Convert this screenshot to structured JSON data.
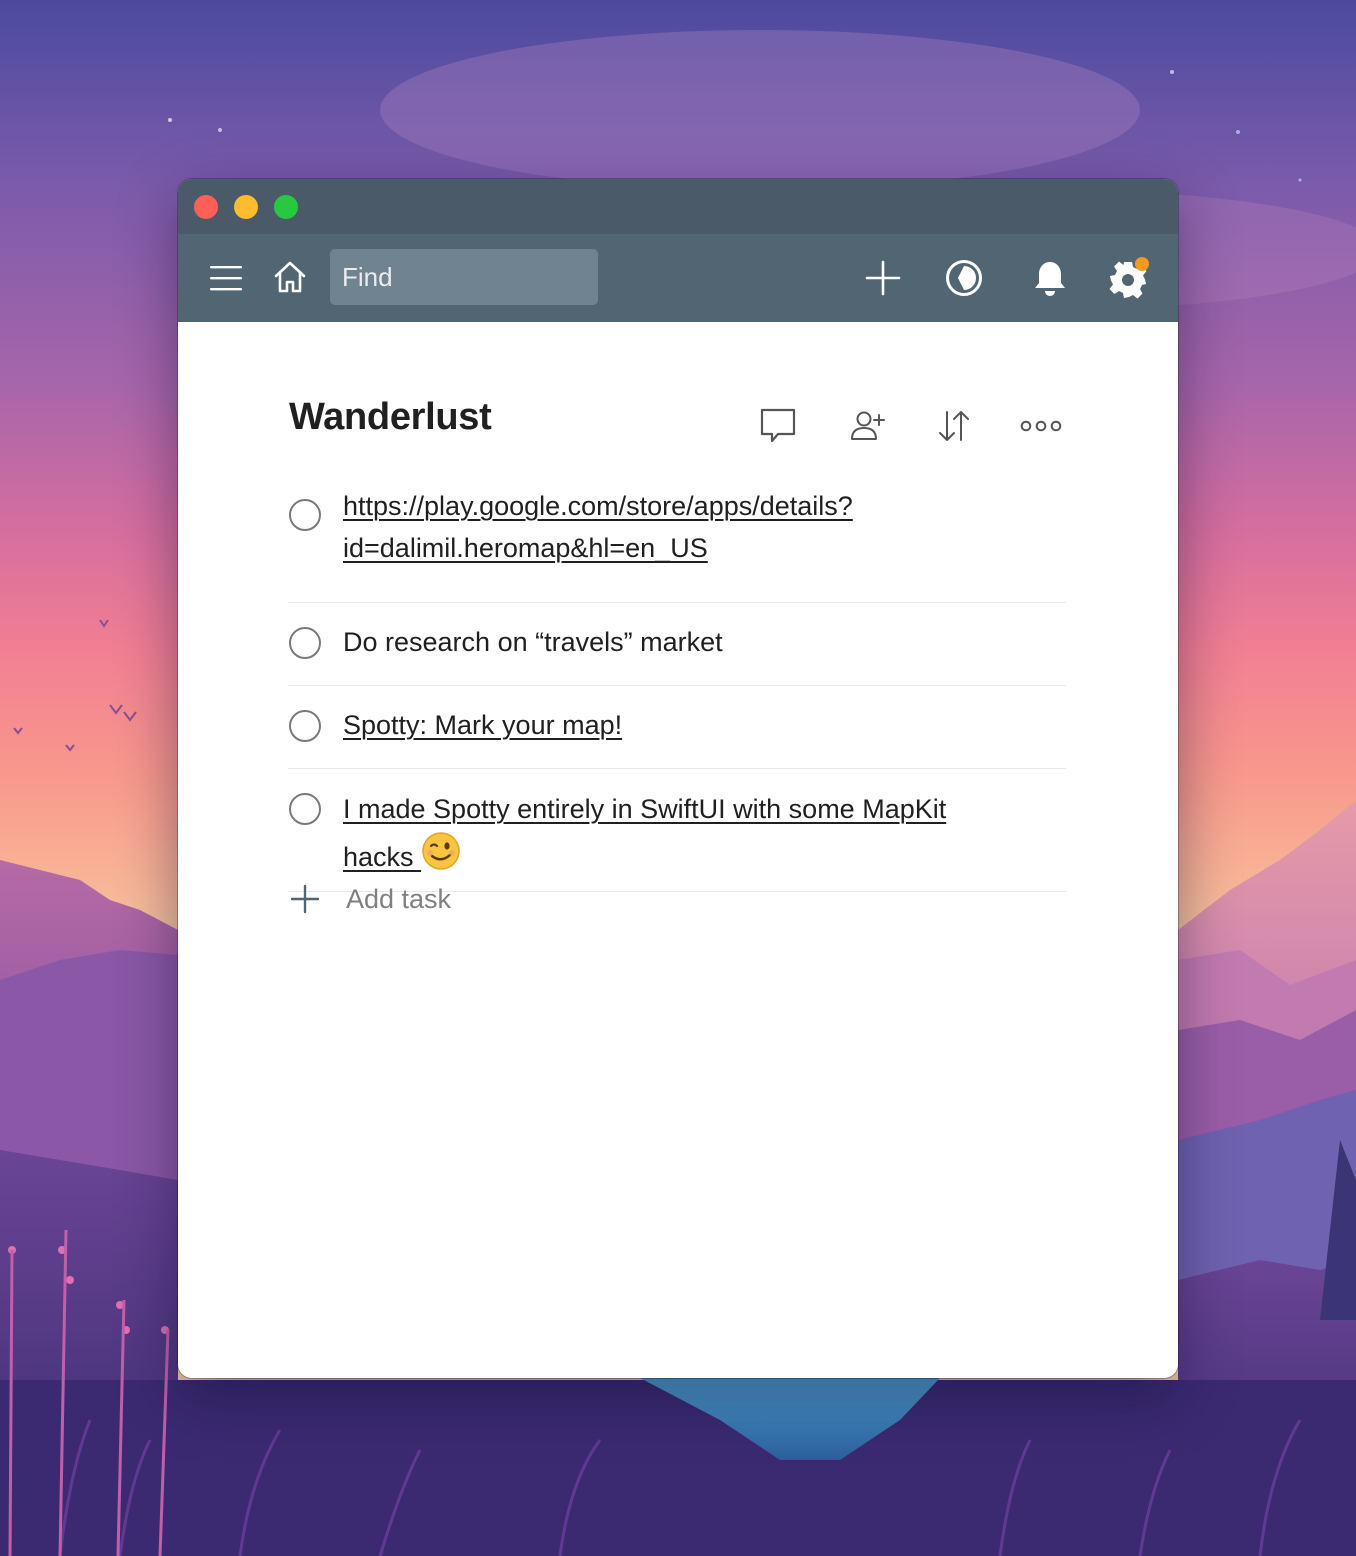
{
  "toolbar": {
    "search_placeholder": "Find"
  },
  "project": {
    "title": "Wanderlust"
  },
  "tasks": [
    {
      "text_line1": "https://play.google.com/store/apps/details?",
      "text_line2": "id=dalimil.heromap&hl=en_US",
      "is_link": true
    },
    {
      "text": "Do research on “travels” market",
      "is_link": false
    },
    {
      "text": "Spotty: Mark your map!",
      "is_link": true
    },
    {
      "text_line1": "I made Spotty entirely in SwiftUI with some MapKit",
      "text_line2": "hacks ",
      "emoji": "winking-face",
      "is_link": true
    }
  ],
  "add_task": {
    "label": "Add task"
  },
  "colors": {
    "titlebar": "#4a5a68",
    "toolbar": "#526573",
    "search_bg": "#708391",
    "notification_dot": "#f39a1e",
    "close": "#fe5f57",
    "minimize": "#febc2e",
    "maximize": "#28c840"
  },
  "icons": {
    "menu": "hamburger-menu-icon",
    "home": "home-icon",
    "add": "plus-icon",
    "productivity": "productivity-icon",
    "notifications": "bell-icon",
    "settings": "gear-icon",
    "comments": "comment-icon",
    "share": "add-person-icon",
    "sort": "sort-icon",
    "more": "more-icon"
  }
}
